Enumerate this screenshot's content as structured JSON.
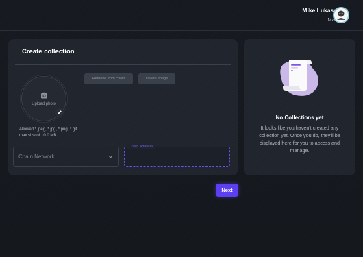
{
  "header": {
    "user_name": "Mike Lukasevicz",
    "user_role": "Manager",
    "avatar_icon": "avatar-icon"
  },
  "create_card": {
    "title": "Create collection",
    "upload_label": "Upload photo",
    "upload_icon": "camera-icon",
    "edit_icon": "pencil-icon",
    "hint_line1": "Allowed *.jpeg, *.jpg, *.png, *.gif",
    "hint_line2": "max size of 10.0 MB",
    "retrieve_button": "Retrieve from chain",
    "delete_button": "Delete image",
    "chain_network_placeholder": "Chain Network",
    "chain_address_label": "Chain Address",
    "chain_address_value": ""
  },
  "empty_state": {
    "title": "No Collections yet",
    "text": "It looks like you haven't created any collection yet. Once you do, they'll be displayed here for you to access and manage.",
    "illustration_icon": "document-illustration-icon"
  },
  "footer": {
    "next_button": "Next"
  },
  "colors": {
    "background": "#161a20",
    "card": "#20252d",
    "accent": "#5b3ff0",
    "focus_border": "#6a4fe8",
    "illustration_blob": "#c9b8e8"
  }
}
